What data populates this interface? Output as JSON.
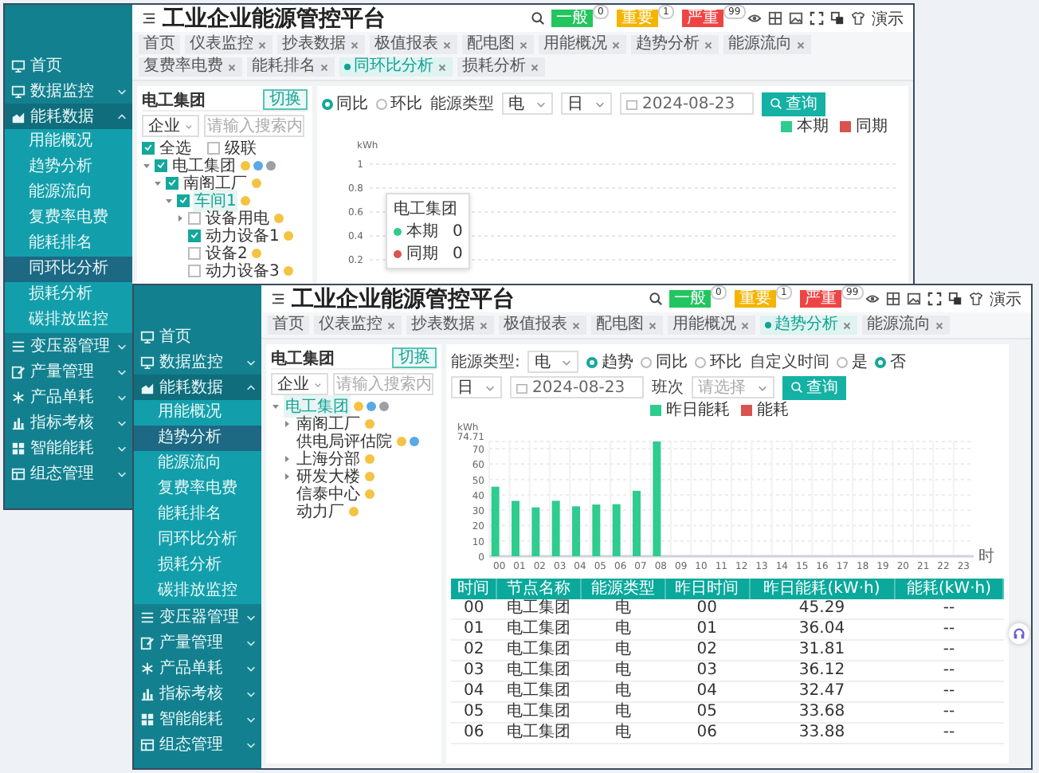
{
  "back_window": {
    "title": "工业企业能源管控平台",
    "alerts": [
      {
        "label": "一般",
        "count": "0",
        "color": "#22c55e"
      },
      {
        "label": "重要",
        "count": "1",
        "color": "#f5b400"
      },
      {
        "label": "严重",
        "count": "99",
        "color": "#ef4444"
      }
    ],
    "user": "演示",
    "sidebar": [
      {
        "kind": "link",
        "label": "首页"
      },
      {
        "kind": "group",
        "label": "数据监控",
        "expanded": false
      },
      {
        "kind": "group",
        "label": "能耗数据",
        "expanded": true,
        "children": [
          {
            "label": "用能概况",
            "selected": false
          },
          {
            "label": "趋势分析",
            "selected": false
          },
          {
            "label": "能源流向",
            "selected": false
          },
          {
            "label": "复费率电费",
            "selected": false
          },
          {
            "label": "能耗排名",
            "selected": false
          },
          {
            "label": "同环比分析",
            "selected": true
          },
          {
            "label": "损耗分析",
            "selected": false
          },
          {
            "label": "碳排放监控",
            "selected": false
          }
        ]
      },
      {
        "kind": "group",
        "label": "变压器管理",
        "expanded": false
      },
      {
        "kind": "group",
        "label": "产量管理",
        "expanded": false
      },
      {
        "kind": "group",
        "label": "产品单耗",
        "expanded": false
      },
      {
        "kind": "group",
        "label": "指标考核",
        "expanded": false
      },
      {
        "kind": "group",
        "label": "智能能耗",
        "expanded": false
      },
      {
        "kind": "group",
        "label": "组态管理",
        "expanded": false
      }
    ],
    "tabs": [
      {
        "label": "首页",
        "closable": false,
        "selected": false
      },
      {
        "label": "仪表监控",
        "closable": true,
        "selected": false
      },
      {
        "label": "抄表数据",
        "closable": true,
        "selected": false
      },
      {
        "label": "极值报表",
        "closable": true,
        "selected": false
      },
      {
        "label": "配电图",
        "closable": true,
        "selected": false
      },
      {
        "label": "用能概况",
        "closable": true,
        "selected": false
      },
      {
        "label": "趋势分析",
        "closable": true,
        "selected": false
      },
      {
        "label": "能源流向",
        "closable": true,
        "selected": false
      },
      {
        "label": "复费率电费",
        "closable": true,
        "selected": false
      },
      {
        "label": "能耗排名",
        "closable": true,
        "selected": false
      },
      {
        "label": "同环比分析",
        "closable": true,
        "selected": true
      },
      {
        "label": "损耗分析",
        "closable": true,
        "selected": false
      }
    ],
    "tree_panel": {
      "title": "电工集团",
      "switch_button": "切换",
      "scope": "企业",
      "search_placeholder": "请输入搜索内",
      "select_all": {
        "label": "全选",
        "checked": true
      },
      "cascade": {
        "label": "级联",
        "checked": false
      },
      "tree": [
        {
          "label": "电工集团",
          "checked": true,
          "expanded": true,
          "selected": false,
          "badges": [
            {
              "color": "#f5c342"
            },
            {
              "color": "#5aa9e6"
            },
            {
              "color": "#9aa0a6"
            }
          ],
          "children": [
            {
              "label": "南阁工厂",
              "checked": true,
              "expanded": true,
              "selected": false,
              "badges": [
                {
                  "color": "#f5c342"
                }
              ],
              "children": [
                {
                  "label": "车间1",
                  "checked": true,
                  "expanded": true,
                  "selected": true,
                  "badges": [
                    {
                      "color": "#f5c342"
                    }
                  ],
                  "children": [
                    {
                      "label": "设备用电",
                      "checked": false,
                      "expanded": false,
                      "selected": false,
                      "badges": [
                        {
                          "color": "#f5c342"
                        }
                      ]
                    },
                    {
                      "label": "动力设备1",
                      "checked": true,
                      "selected": false,
                      "badges": [
                        {
                          "color": "#f5c342"
                        }
                      ]
                    },
                    {
                      "label": "设备2",
                      "checked": false,
                      "selected": false,
                      "badges": [
                        {
                          "color": "#f5c342"
                        }
                      ]
                    },
                    {
                      "label": "动力设备3",
                      "checked": false,
                      "selected": false,
                      "badges": [
                        {
                          "color": "#f5c342"
                        }
                      ]
                    }
                  ]
                }
              ]
            }
          ]
        }
      ]
    },
    "chart_panel": {
      "compare": [
        {
          "label": "同比",
          "selected": true
        },
        {
          "label": "环比",
          "selected": false
        }
      ],
      "energy_type_label": "能源类型",
      "energy_type": "电",
      "period": "日",
      "date": "2024-08-23",
      "query_button": "查询",
      "legend": [
        {
          "label": "本期",
          "color": "#2ecc8f"
        },
        {
          "label": "同期",
          "color": "#d9534f"
        }
      ],
      "y_unit": "kWh",
      "y_ticks": [
        "1",
        "0.8",
        "0.6",
        "0.4",
        "0.2"
      ],
      "tooltip": {
        "title": "电工集团",
        "rows": [
          {
            "label": "本期",
            "value": "0",
            "color": "#2ecc8f"
          },
          {
            "label": "同期",
            "value": "0",
            "color": "#d9534f"
          }
        ]
      }
    }
  },
  "front_window": {
    "title": "工业企业能源管控平台",
    "alerts": [
      {
        "label": "一般",
        "count": "0",
        "color": "#22c55e"
      },
      {
        "label": "重要",
        "count": "1",
        "color": "#f5b400"
      },
      {
        "label": "严重",
        "count": "99",
        "color": "#ef4444"
      }
    ],
    "user": "演示",
    "sidebar": [
      {
        "kind": "link",
        "label": "首页"
      },
      {
        "kind": "group",
        "label": "数据监控",
        "expanded": false
      },
      {
        "kind": "group",
        "label": "能耗数据",
        "expanded": true,
        "children": [
          {
            "label": "用能概况",
            "selected": false
          },
          {
            "label": "趋势分析",
            "selected": true
          },
          {
            "label": "能源流向",
            "selected": false
          },
          {
            "label": "复费率电费",
            "selected": false
          },
          {
            "label": "能耗排名",
            "selected": false
          },
          {
            "label": "同环比分析",
            "selected": false
          },
          {
            "label": "损耗分析",
            "selected": false
          },
          {
            "label": "碳排放监控",
            "selected": false
          }
        ]
      },
      {
        "kind": "group",
        "label": "变压器管理",
        "expanded": false
      },
      {
        "kind": "group",
        "label": "产量管理",
        "expanded": false
      },
      {
        "kind": "group",
        "label": "产品单耗",
        "expanded": false
      },
      {
        "kind": "group",
        "label": "指标考核",
        "expanded": false
      },
      {
        "kind": "group",
        "label": "智能能耗",
        "expanded": false
      },
      {
        "kind": "group",
        "label": "组态管理",
        "expanded": false
      }
    ],
    "tabs": [
      {
        "label": "首页",
        "closable": false,
        "selected": false
      },
      {
        "label": "仪表监控",
        "closable": true,
        "selected": false
      },
      {
        "label": "抄表数据",
        "closable": true,
        "selected": false
      },
      {
        "label": "极值报表",
        "closable": true,
        "selected": false
      },
      {
        "label": "配电图",
        "closable": true,
        "selected": false
      },
      {
        "label": "用能概况",
        "closable": true,
        "selected": false
      },
      {
        "label": "趋势分析",
        "closable": true,
        "selected": true
      },
      {
        "label": "能源流向",
        "closable": true,
        "selected": false
      }
    ],
    "tree_panel": {
      "title": "电工集团",
      "switch_button": "切换",
      "scope": "企业",
      "search_placeholder": "请输入搜索内",
      "tree": [
        {
          "label": "电工集团",
          "expanded": true,
          "selected": true,
          "badges": [
            {
              "color": "#f5c342"
            },
            {
              "color": "#5aa9e6"
            },
            {
              "color": "#9aa0a6"
            }
          ],
          "children": [
            {
              "label": "南阁工厂",
              "expanded": false,
              "selected": false,
              "badges": [
                {
                  "color": "#f5c342"
                }
              ]
            },
            {
              "label": "供电局评估院",
              "selected": false,
              "badges": [
                {
                  "color": "#f5c342"
                },
                {
                  "color": "#5aa9e6"
                }
              ]
            },
            {
              "label": "上海分部",
              "expanded": false,
              "selected": false,
              "badges": [
                {
                  "color": "#f5c342"
                }
              ]
            },
            {
              "label": "研发大楼",
              "expanded": false,
              "selected": false,
              "badges": [
                {
                  "color": "#f5c342"
                }
              ]
            },
            {
              "label": "信泰中心",
              "selected": false,
              "badges": [
                {
                  "color": "#f5c342"
                }
              ]
            },
            {
              "label": "动力厂",
              "selected": false,
              "badges": [
                {
                  "color": "#f5c342"
                }
              ]
            }
          ]
        }
      ]
    },
    "filters": {
      "energy_type_label": "能源类型:",
      "energy_type": "电",
      "mode": [
        {
          "label": "趋势",
          "selected": true
        },
        {
          "label": "同比",
          "selected": false
        },
        {
          "label": "环比",
          "selected": false
        }
      ],
      "custom_time_label": "自定义时间",
      "custom_time": [
        {
          "label": "是",
          "selected": false
        },
        {
          "label": "否",
          "selected": true
        }
      ],
      "period": "日",
      "date": "2024-08-23",
      "shift_label": "班次",
      "shift_placeholder": "请选择",
      "query_button": "查询"
    },
    "chart_data": {
      "type": "bar",
      "ylabel": "kWh",
      "xlabel": "时",
      "categories": [
        "00",
        "01",
        "02",
        "03",
        "04",
        "05",
        "06",
        "07",
        "08",
        "09",
        "10",
        "11",
        "12",
        "13",
        "14",
        "15",
        "16",
        "17",
        "18",
        "19",
        "20",
        "21",
        "22",
        "23"
      ],
      "series": [
        {
          "name": "昨日能耗",
          "color": "#2ecc8f",
          "values": [
            45.29,
            36.04,
            31.81,
            36.12,
            32.47,
            33.68,
            33.88,
            42.6,
            74.71,
            null,
            null,
            null,
            null,
            null,
            null,
            null,
            null,
            null,
            null,
            null,
            null,
            null,
            null,
            null
          ]
        },
        {
          "name": "能耗",
          "color": "#d9534f",
          "values": [
            null,
            null,
            null,
            null,
            null,
            null,
            null,
            null,
            null,
            null,
            null,
            null,
            null,
            null,
            null,
            null,
            null,
            null,
            null,
            null,
            null,
            null,
            null,
            null
          ]
        }
      ],
      "grid": true,
      "ylim": [
        0,
        74.71
      ],
      "yticks": [
        0,
        10,
        20,
        30,
        40,
        50,
        60,
        70,
        {
          "value": 74.71,
          "label": "74.71"
        }
      ]
    },
    "table": {
      "columns": [
        "时间",
        "节点名称",
        "能源类型",
        "昨日时间",
        "昨日能耗(kW·h)",
        "能耗(kW·h)"
      ],
      "rows": [
        [
          "00",
          "电工集团",
          "电",
          "00",
          "45.29",
          "--"
        ],
        [
          "01",
          "电工集团",
          "电",
          "01",
          "36.04",
          "--"
        ],
        [
          "02",
          "电工集团",
          "电",
          "02",
          "31.81",
          "--"
        ],
        [
          "03",
          "电工集团",
          "电",
          "03",
          "36.12",
          "--"
        ],
        [
          "04",
          "电工集团",
          "电",
          "04",
          "32.47",
          "--"
        ],
        [
          "05",
          "电工集团",
          "电",
          "05",
          "33.68",
          "--"
        ],
        [
          "06",
          "电工集团",
          "电",
          "06",
          "33.88",
          "--"
        ]
      ]
    }
  }
}
